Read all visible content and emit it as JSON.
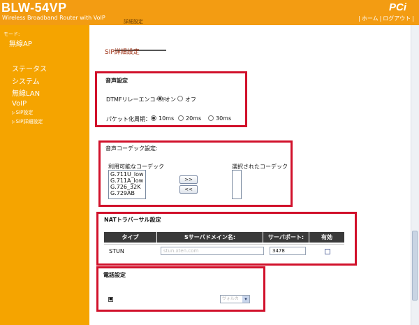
{
  "header": {
    "brand": "BLW-54VP",
    "subtitle": "Wireless Broadband Router with VoIP",
    "logo": "PCi",
    "home_link": "ホーム",
    "logout_link": "ログアウト",
    "active_tab": "詳細設定"
  },
  "sidebar": {
    "mode_label": "モード:",
    "mode_value": "無線AP",
    "items": [
      {
        "label": "ステータス"
      },
      {
        "label": "システム"
      },
      {
        "label": "無線LAN"
      },
      {
        "label": "VoIP"
      }
    ],
    "sub_items": [
      {
        "label": "SIP設定"
      },
      {
        "label": "SIP詳細設定"
      }
    ]
  },
  "main": {
    "page_title": "SIP詳細設定",
    "voice": {
      "title": "音声設定",
      "dtmf_label": "DTMFリレーエンコード",
      "dtmf_on": "オン",
      "dtmf_off": "オフ",
      "dtmf_selected": "オン",
      "packet_label": "パケット化周期：",
      "packet_options": [
        "10ms",
        "20ms",
        "30ms"
      ],
      "packet_selected": "10ms"
    },
    "codec": {
      "title": "音声コーデック設定:",
      "available_label": "利用可能なコーデック",
      "selected_label": "選択されたコーデック",
      "available": [
        "G.711U_low",
        "G.711A_low",
        "G.726_32K",
        "G.729AB"
      ],
      "add_button": ">>",
      "remove_button": "<<"
    },
    "nat": {
      "title": "NATトラバーサル設定",
      "headers": [
        "タイプ",
        "Sサーバドメイン名:",
        "サーバポート:",
        "有効"
      ],
      "row": {
        "type": "STUN",
        "domain": "stun.xten.com",
        "port": "3478",
        "enabled": false
      }
    },
    "phone": {
      "title": "電話設定",
      "select_value": "ヴォルカ"
    }
  },
  "colors": {
    "brand_orange": "#f39c12",
    "sidebar_orange": "#f5a400",
    "highlight_red": "#d1112b",
    "title_red": "#9a2a0c"
  }
}
